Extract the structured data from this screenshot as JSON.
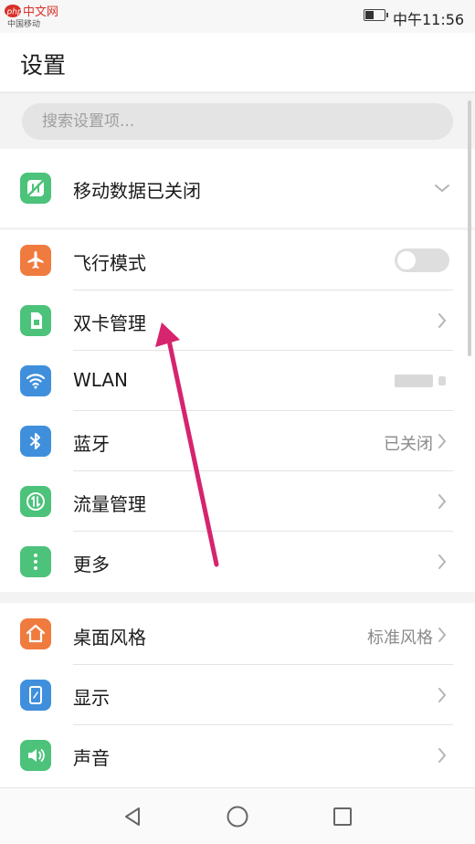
{
  "status_bar": {
    "watermark": "php中文网",
    "carrier": "中国移动",
    "time": "中午11:56",
    "battery_level": 0.4
  },
  "header": {
    "title": "设置"
  },
  "search": {
    "placeholder": "搜索设置项..."
  },
  "rows": {
    "mobile_data": {
      "label": "移动数据已关闭",
      "icon": "mobile-data-off-icon",
      "color": "#4cc27a"
    },
    "airplane": {
      "label": "飞行模式",
      "icon": "airplane-icon",
      "color": "#f07b3f",
      "toggle": false
    },
    "dual_sim": {
      "label": "双卡管理",
      "icon": "sim-card-icon",
      "color": "#4cc27a"
    },
    "wlan": {
      "label": "WLAN",
      "icon": "wifi-icon",
      "color": "#3f8fdc"
    },
    "bluetooth": {
      "label": "蓝牙",
      "value": "已关闭",
      "icon": "bluetooth-icon",
      "color": "#3f8fdc"
    },
    "data_usage": {
      "label": "流量管理",
      "icon": "data-usage-icon",
      "color": "#4cc27a"
    },
    "more": {
      "label": "更多",
      "icon": "more-icon",
      "color": "#4cc27a"
    },
    "desktop_style": {
      "label": "桌面风格",
      "value": "标准风格",
      "icon": "home-icon",
      "color": "#f07b3f"
    },
    "display": {
      "label": "显示",
      "icon": "display-icon",
      "color": "#3f8fdc"
    },
    "sound": {
      "label": "声音",
      "icon": "speaker-icon",
      "color": "#4cc27a"
    }
  },
  "annotation": {
    "arrow_color": "#d6246e"
  }
}
